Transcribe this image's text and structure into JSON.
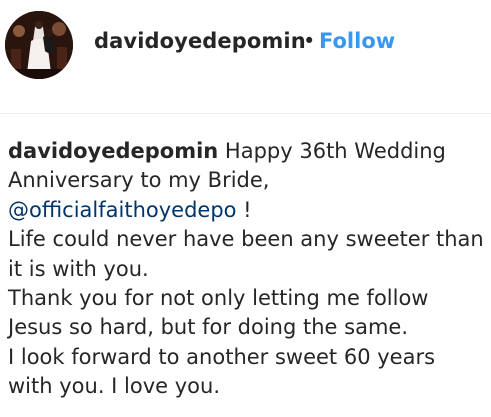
{
  "header": {
    "username": "davidoyedepomin",
    "separator": "•",
    "follow_label": "Follow"
  },
  "caption": {
    "username": "davidoyedepomin",
    "line1_rest": " Happy 36th Wedding",
    "line2": "Anniversary to my Bride,",
    "mention": "@officialfaithoyedepo",
    "mention_suffix": " !",
    "line4": "Life could never have been any sweeter than",
    "line5": "it is with you.",
    "line6": "Thank you for not only letting me follow",
    "line7": "Jesus so hard, but for doing the same.",
    "line8": "I look forward to another sweet 60 years",
    "line9": "with you. I love you."
  },
  "colors": {
    "follow_blue": "#3897f0",
    "mention_blue": "#003569",
    "text": "#262626"
  }
}
